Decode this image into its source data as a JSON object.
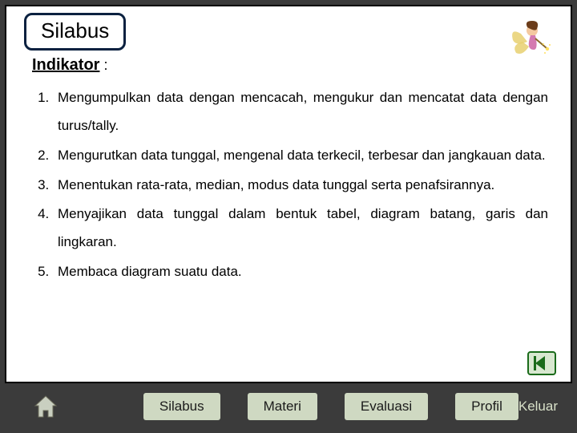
{
  "title": "Silabus",
  "section_label": "Indikator",
  "colon": " :",
  "items": [
    "Mengumpulkan data dengan mencacah, mengukur dan mencatat data dengan turus/tally.",
    "Mengurutkan data tunggal, mengenal data terkecil, terbesar dan jangkauan data.",
    "Menentukan rata-rata, median, modus data tunggal serta penafsirannya.",
    "Menyajikan data tunggal dalam bentuk tabel, diagram batang, garis dan lingkaran.",
    "Membaca diagram suatu data."
  ],
  "nav": {
    "silabus": "Silabus",
    "materi": "Materi",
    "evaluasi": "Evaluasi",
    "profil": "Profil",
    "keluar": "Keluar"
  }
}
